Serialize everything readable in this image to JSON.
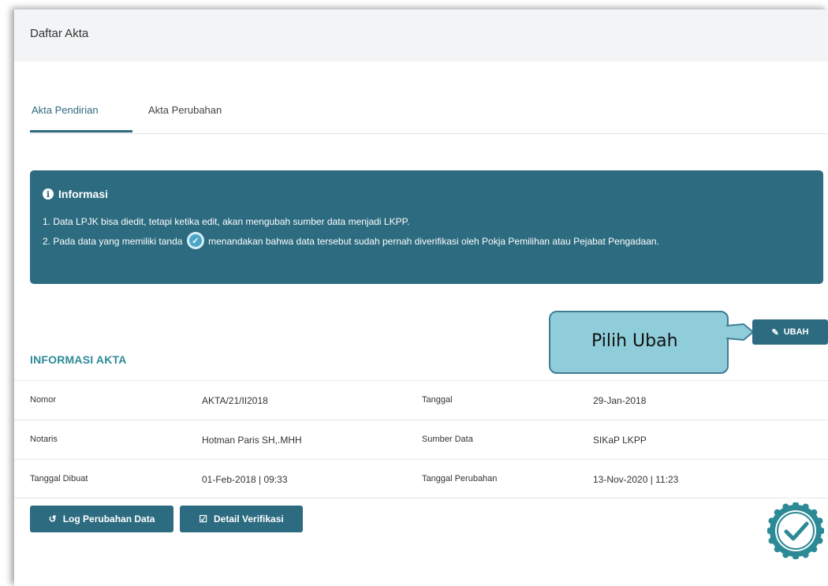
{
  "header": {
    "title": "Daftar Akta"
  },
  "tabs": [
    {
      "label": "Akta Pendirian",
      "active": true
    },
    {
      "label": "Akta Perubahan",
      "active": false
    }
  ],
  "info": {
    "title": "Informasi",
    "line1": "1. Data LPJK bisa diedit, tetapi ketika edit, akan mengubah sumber data menjadi LKPP.",
    "line2_before": "2. Pada data yang memiliki tanda",
    "line2_after": "menandakan bahwa data tersebut sudah pernah diverifikasi oleh Pokja Pemilihan atau Pejabat Pengadaan."
  },
  "ubah_label": "UBAH",
  "callout": {
    "text": "Pilih Ubah"
  },
  "section_title": "INFORMASI AKTA",
  "rows": [
    {
      "l1": "Nomor",
      "v1": "AKTA/21/II2018",
      "l2": "Tanggal",
      "v2": "29-Jan-2018"
    },
    {
      "l1": "Notaris",
      "v1": "Hotman Paris SH,.MHH",
      "l2": "Sumber Data",
      "v2": "SIKaP LKPP"
    },
    {
      "l1": "Tanggal Dibuat",
      "v1": "01-Feb-2018 | 09:33",
      "l2": "Tanggal Perubahan",
      "v2": "13-Nov-2020 | 11:23"
    }
  ],
  "buttons": {
    "log": "Log Perubahan Data",
    "detail": "Detail Verifikasi"
  },
  "colors": {
    "primary": "#2c6b80",
    "accent_title": "#2d8a99",
    "callout": "#90cddb"
  },
  "icons": [
    "info-icon",
    "check-icon",
    "edit-icon",
    "history-icon",
    "checkbox-icon",
    "verified-badge-icon"
  ]
}
